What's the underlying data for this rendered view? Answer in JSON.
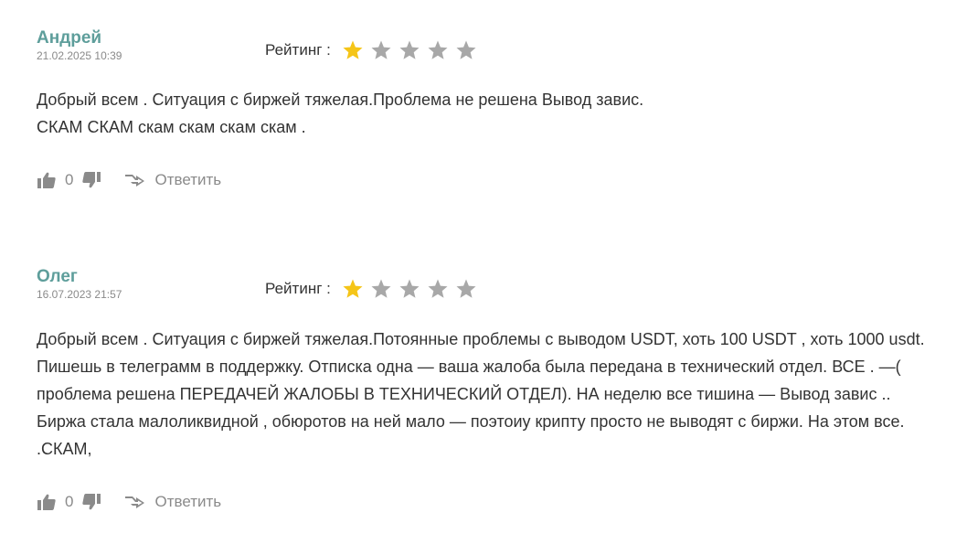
{
  "colors": {
    "author": "#5e9e9b",
    "star_filled": "#f5c518",
    "star_empty": "#a8a8a8",
    "muted": "#8a8a8a",
    "text": "#333333"
  },
  "reviews": [
    {
      "author": "Андрей",
      "date": "21.02.2025 10:39",
      "rating_label": "Рейтинг :",
      "rating": 1,
      "rating_max": 5,
      "text_lines": [
        "Добрый всем . Ситуация с биржей тяжелая.Проблема не решена Вывод завис.",
        "СКАМ СКАМ скам скам скам скам ."
      ],
      "likes": "0",
      "reply_label": "Ответить",
      "icons": {
        "like": "thumbs-up-icon",
        "dislike": "thumbs-down-icon",
        "reply": "reply-arrow-icon"
      }
    },
    {
      "author": "Олег",
      "date": "16.07.2023 21:57",
      "rating_label": "Рейтинг :",
      "rating": 1,
      "rating_max": 5,
      "text_lines": [
        "Добрый всем . Ситуация с биржей тяжелая.Потоянные проблемы с выводом USDT, хоть 100 USDT , хоть 1000 usdt.",
        "Пишешь в телеграмм в поддержку. Отписка одна — ваша жалоба была передана в технический отдел. ВСЕ . —(",
        "проблема решена ПЕРЕДАЧЕЙ ЖАЛОБЫ В ТЕХНИЧЕСКИЙ ОТДЕЛ). НА неделю все тишина — Вывод завис ..",
        "Биржа стала малоликвидной , обюротов на ней мало — поэтоиу крипту просто не выводят с биржи. На этом все.",
        ".СКАМ,"
      ],
      "likes": "0",
      "reply_label": "Ответить",
      "icons": {
        "like": "thumbs-up-icon",
        "dislike": "thumbs-down-icon",
        "reply": "reply-arrow-icon"
      }
    }
  ]
}
